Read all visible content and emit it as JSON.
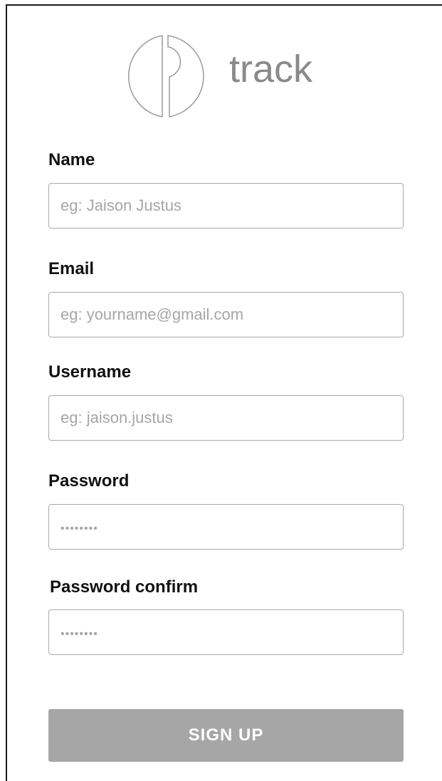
{
  "brand": {
    "logo_icon": "track-logo-icon",
    "name": "track"
  },
  "form": {
    "fields": [
      {
        "label": "Name",
        "placeholder": "eg: Jaison Justus"
      },
      {
        "label": "Email",
        "placeholder": "eg: yourname@gmail.com"
      },
      {
        "label": "Username",
        "placeholder": "eg: jaison.justus"
      },
      {
        "label": "Password",
        "placeholder": "••••••••"
      },
      {
        "label": "Password confirm",
        "placeholder": "••••••••"
      }
    ],
    "submit_label": "SIGN UP"
  },
  "colors": {
    "button_bg": "#a6a6a6",
    "logo_text": "#8a8a8a",
    "input_border": "#a9a9a9"
  }
}
